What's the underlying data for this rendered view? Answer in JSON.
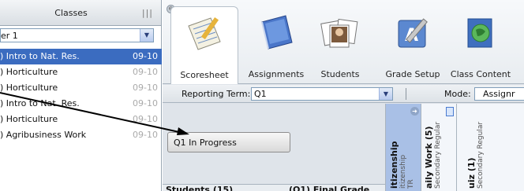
{
  "sidebar": {
    "title": "Classes",
    "grip": "|||",
    "term_select": "er 1",
    "classes": [
      {
        "name": ") Intro to Nat. Res.",
        "period": "09-10"
      },
      {
        "name": ") Horticulture",
        "period": "09-10"
      },
      {
        "name": ") Horticulture",
        "period": "09-10"
      },
      {
        "name": ") Intro to Nat. Res.",
        "period": "09-10"
      },
      {
        "name": ") Horticulture",
        "period": "09-10"
      },
      {
        "name": ") Agribusiness Work",
        "period": "09-10"
      }
    ]
  },
  "toolbar": {
    "collapse": "⊖",
    "tools": [
      {
        "label": "Scoresheet",
        "icon": "scoresheet-icon"
      },
      {
        "label": "Assignments",
        "icon": "assignments-icon"
      },
      {
        "label": "Students",
        "icon": "students-icon"
      },
      {
        "label": "Grade Setup",
        "icon": "grade-setup-icon"
      },
      {
        "label": "Class Content",
        "icon": "class-content-icon"
      }
    ]
  },
  "term_bar": {
    "label": "Reporting Term:",
    "value": "Q1",
    "mode_label": "Mode:",
    "mode_value": "Assignr"
  },
  "status": {
    "label": "Q1 In Progress"
  },
  "grid": {
    "students_header": "Students (15)",
    "final_header": "(Q1) Final Grade",
    "columns": [
      {
        "title": "itizenship",
        "sub": "itizenship",
        "sub2": "TR"
      },
      {
        "title": "aily Work (5)",
        "sub": "Secondary Regular"
      },
      {
        "title": "uiz (1)",
        "sub": "Secondary Regular"
      }
    ]
  },
  "colors": {
    "selection": "#3b6cc0",
    "highlight_column": "#a9c0e6"
  }
}
